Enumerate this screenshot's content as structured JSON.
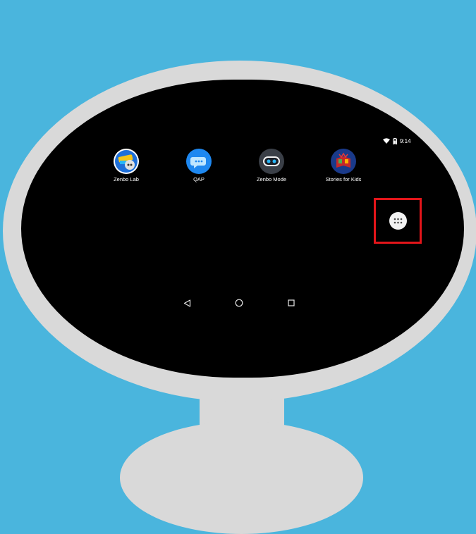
{
  "status_bar": {
    "time": "9:14",
    "wifi_icon": "wifi-icon",
    "battery_icon": "battery-icon"
  },
  "apps": [
    {
      "label": "Zenbo Lab",
      "icon": "zenbo-lab-icon",
      "color": "#1e6fd9"
    },
    {
      "label": "QAP",
      "icon": "qap-chat-icon",
      "color": "#1e88f0"
    },
    {
      "label": "Zenbo Mode",
      "icon": "zenbo-face-icon",
      "color": "#3a3f47"
    },
    {
      "label": "Stories for Kids",
      "icon": "storybook-icon",
      "color": "#1a3a8a"
    }
  ],
  "app_drawer": {
    "icon": "app-drawer-icon",
    "highlight_color": "#e3151a"
  },
  "nav_bar": {
    "back": "back-icon",
    "home": "home-icon",
    "recents": "recents-icon"
  },
  "colors": {
    "background": "#4ab5dd",
    "robot_body": "#d9d9d9",
    "screen": "#000000"
  }
}
